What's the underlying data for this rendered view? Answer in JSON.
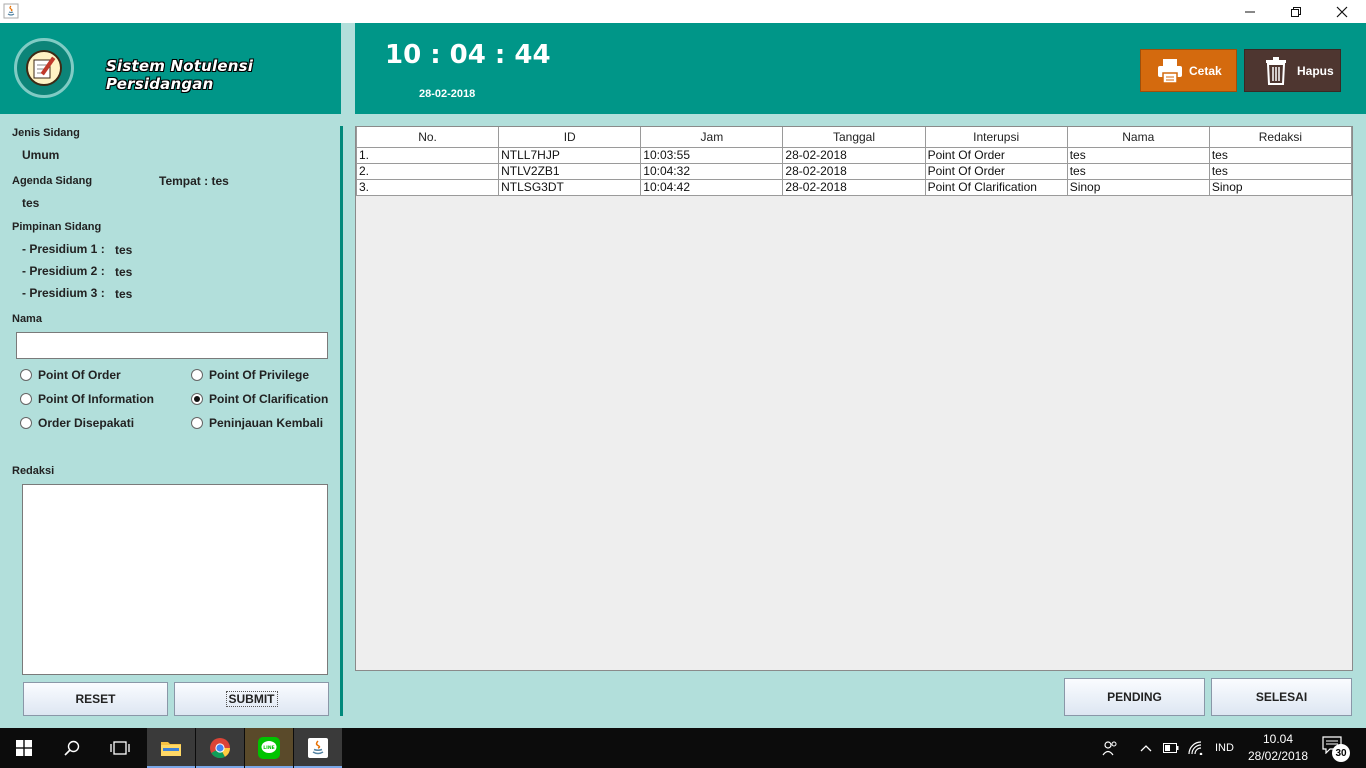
{
  "window": {
    "minimize_icon": "minimize-icon",
    "maximize_icon": "restore-icon",
    "close_icon": "close-icon"
  },
  "header": {
    "app_title": "Sistem Notulensi Persidangan",
    "clock": "10 : 04 : 44",
    "date": "28-02-2018",
    "cetak_label": "Cetak",
    "hapus_label": "Hapus",
    "colors": {
      "teal": "#009688",
      "cetak": "#d46a0e",
      "hapus": "#4e3630"
    }
  },
  "form": {
    "jenis_label": "Jenis Sidang",
    "jenis_value": "Umum",
    "agenda_label": "Agenda Sidang",
    "agenda_value": "tes",
    "tempat_label": "Tempat : tes",
    "pimpinan_label": "Pimpinan Sidang",
    "presidium": [
      {
        "label": "- Presidium 1 :",
        "value": "tes"
      },
      {
        "label": "- Presidium 2 :",
        "value": "tes"
      },
      {
        "label": "- Presidium 3 :",
        "value": "tes"
      }
    ],
    "nama_label": "Nama",
    "nama_value": "",
    "radios": [
      {
        "label": "Point Of Order",
        "checked": false
      },
      {
        "label": "Point Of Privilege",
        "checked": false
      },
      {
        "label": "Point Of Information",
        "checked": false
      },
      {
        "label": "Point Of Clarification",
        "checked": true
      },
      {
        "label": "Order Disepakati",
        "checked": false
      },
      {
        "label": "Peninjauan Kembali",
        "checked": false
      }
    ],
    "redaksi_label": "Redaksi",
    "redaksi_value": "",
    "reset_label": "RESET",
    "submit_label": "SUBMIT"
  },
  "table": {
    "columns": [
      "No.",
      "ID",
      "Jam",
      "Tanggal",
      "Interupsi",
      "Nama",
      "Redaksi"
    ],
    "rows": [
      [
        "1.",
        "NTLL7HJP",
        "10:03:55",
        "28-02-2018",
        "Point Of Order",
        "tes",
        "tes"
      ],
      [
        "2.",
        "NTLV2ZB1",
        "10:04:32",
        "28-02-2018",
        "Point Of Order",
        "tes",
        "tes"
      ],
      [
        "3.",
        "NTLSG3DT",
        "10:04:42",
        "28-02-2018",
        "Point Of Clarification",
        "Sinop",
        "Sinop"
      ]
    ]
  },
  "actions": {
    "pending_label": "PENDING",
    "selesai_label": "SELESAI"
  },
  "taskbar": {
    "language": "IND",
    "time": "10.04",
    "date": "28/02/2018",
    "notification_count": "30"
  }
}
